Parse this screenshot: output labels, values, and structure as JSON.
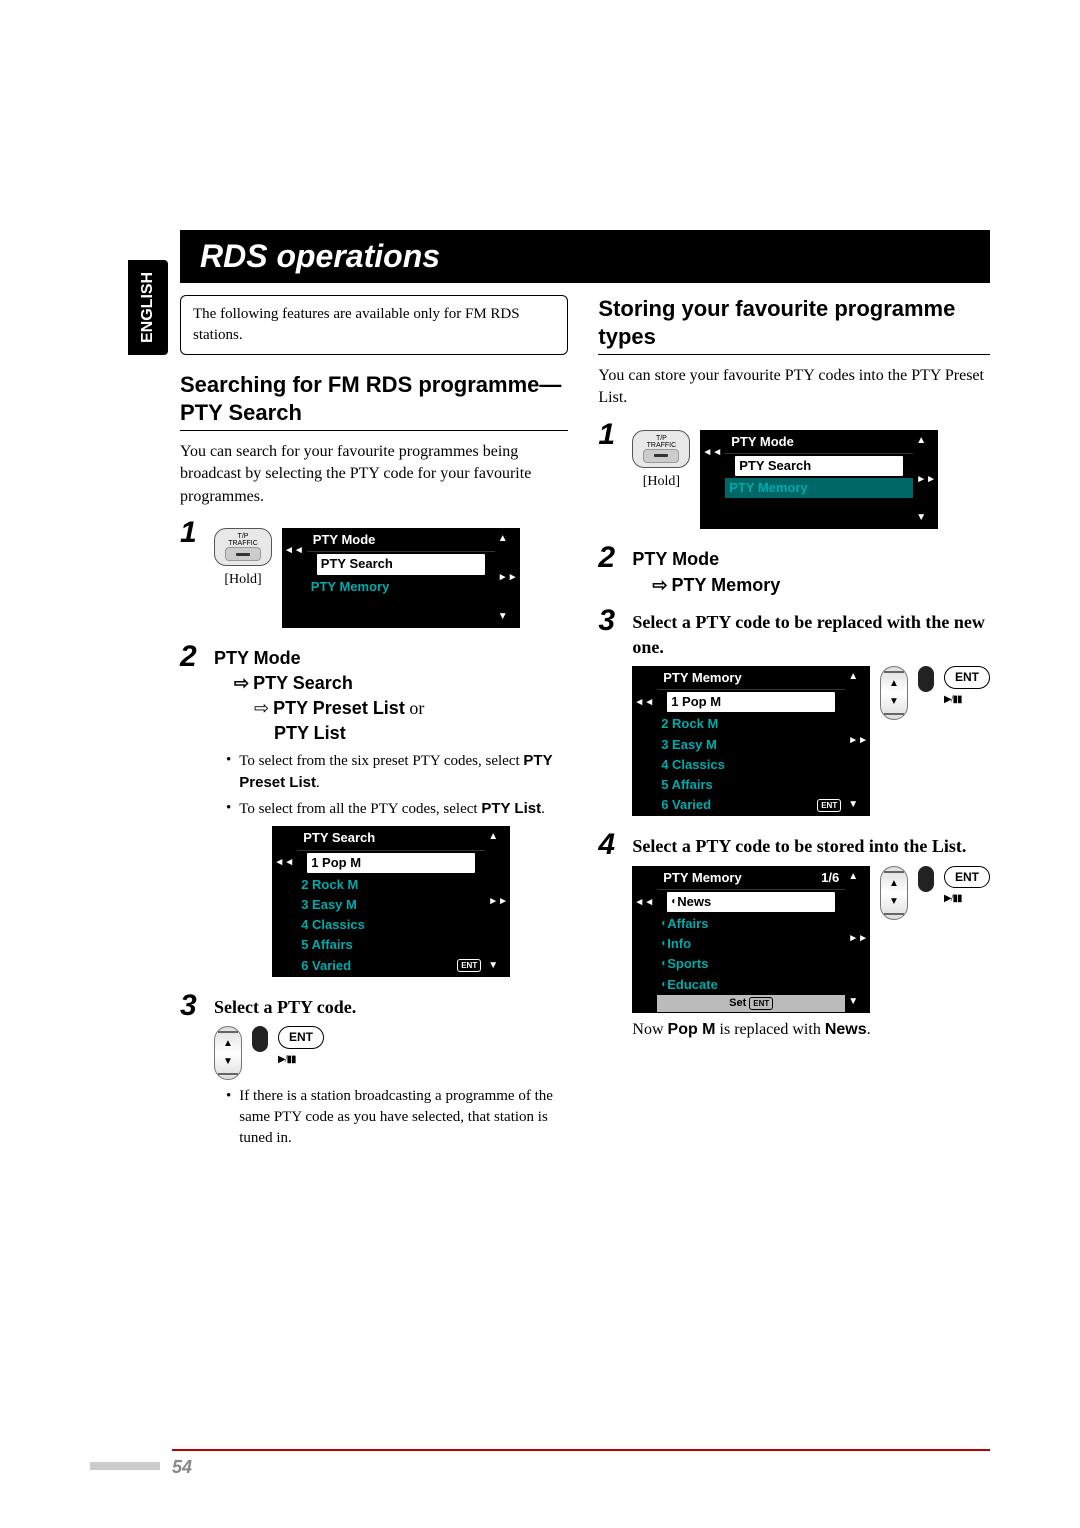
{
  "language_tab": "ENGLISH",
  "page_title": "RDS operations",
  "note_box": "The following features are available only for FM RDS stations.",
  "page_number": "54",
  "left": {
    "heading": "Searching for FM RDS programme—PTY Search",
    "intro": "You can search for your favourite programmes being broadcast by selecting the PTY code for your favourite programmes.",
    "step1": {
      "tp_top": "T/P",
      "tp_bottom": "TRAFFIC",
      "hold": "[Hold]",
      "screen_title": "PTY Mode",
      "row_selected": "PTY Search",
      "row_dim": "PTY Memory"
    },
    "step2": {
      "line1": "PTY Mode",
      "line2": "PTY Search",
      "line3a": "PTY Preset List",
      "line3_or": " or",
      "line4": "PTY List",
      "bullet1_a": "To select from the six preset PTY codes, select ",
      "bullet1_b": "PTY Preset List",
      "bullet1_c": ".",
      "bullet2_a": "To select from all the PTY codes, select ",
      "bullet2_b": "PTY List",
      "bullet2_c": ".",
      "list_title": "PTY Search",
      "items": [
        "1  Pop M",
        "2  Rock M",
        "3  Easy M",
        "4  Classics",
        "5  Affairs",
        "6  Varied"
      ]
    },
    "step3": {
      "title": "Select a PTY code.",
      "ent": "ENT",
      "bullet": "If there is a station broadcasting a programme of the same PTY code as you have selected, that station is tuned in."
    }
  },
  "right": {
    "heading": "Storing your favourite programme types",
    "intro": "You can store your favourite PTY codes into the PTY Preset List.",
    "step1": {
      "tp_top": "T/P",
      "tp_bottom": "TRAFFIC",
      "hold": "[Hold]",
      "screen_title": "PTY Mode",
      "row1": "PTY Search",
      "row_selected": "PTY Memory"
    },
    "step2": {
      "line1": "PTY Mode",
      "line2": "PTY Memory"
    },
    "step3": {
      "title": "Select a PTY code to be replaced with the new one.",
      "list_title": "PTY Memory",
      "items": [
        "1  Pop M",
        "2  Rock M",
        "3  Easy M",
        "4  Classics",
        "5  Affairs",
        "6  Varied"
      ],
      "ent": "ENT"
    },
    "step4": {
      "title": "Select a PTY code to be stored into the List.",
      "list_title": "PTY Memory",
      "counter": "1/6",
      "items": [
        "News",
        "Affairs",
        "Info",
        "Sports",
        "Educate"
      ],
      "set": "Set",
      "ent_small": "ENT",
      "ent": "ENT",
      "result_a": "Now ",
      "result_b": "Pop M",
      "result_c": " is replaced with ",
      "result_d": "News",
      "result_e": "."
    }
  }
}
